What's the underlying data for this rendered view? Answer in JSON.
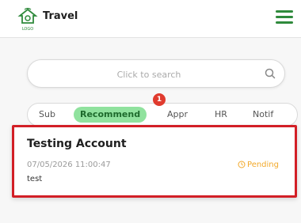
{
  "header": {
    "logo_caption": "LOGO",
    "brand": "Travel"
  },
  "search": {
    "placeholder": "Click to search"
  },
  "tabs": [
    {
      "label": "Sub"
    },
    {
      "label": "Recommend",
      "badge": "1"
    },
    {
      "label": "Appr"
    },
    {
      "label": "HR"
    },
    {
      "label": "Notif"
    }
  ],
  "card": {
    "title": "Testing Account",
    "datetime": "07/05/2026 11:00:47",
    "description": "test",
    "status": "Pending"
  },
  "colors": {
    "accent": "#2f8a3c",
    "active_tab": "#90e29e",
    "badge": "#e03b2e",
    "pending": "#f2a92b",
    "highlight_border": "#d21f26"
  }
}
